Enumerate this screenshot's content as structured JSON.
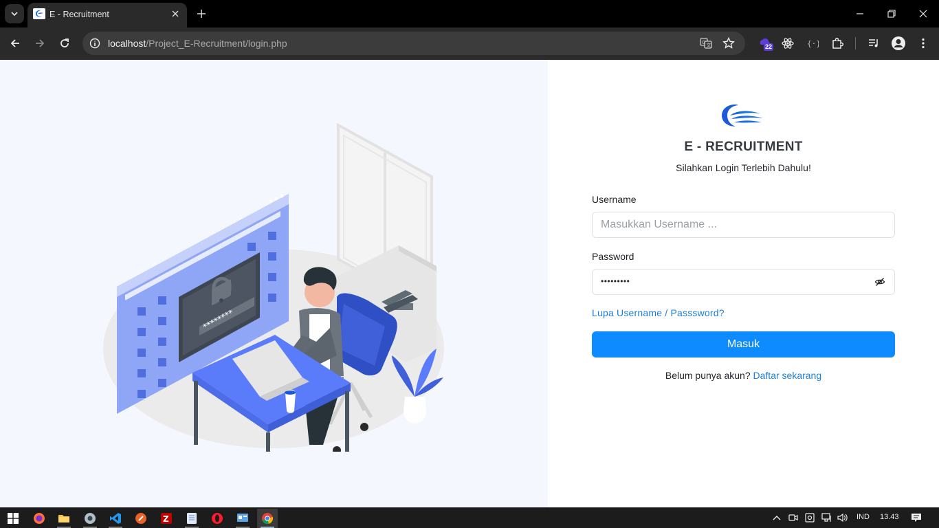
{
  "browser": {
    "tab_title": "E - Recruitment",
    "url_host": "localhost",
    "url_path": "/Project_E-Recruitment/login.php",
    "extension_badge": "22"
  },
  "login": {
    "brand_title": "E - RECRUITMENT",
    "subtitle": "Silahkan Login Terlebih Dahulu!",
    "username_label": "Username",
    "username_placeholder": "Masukkan Username ...",
    "password_label": "Password",
    "password_mask": "•••••••••",
    "forgot_link": "Lupa Username / Passsword?",
    "submit_label": "Masuk",
    "register_prompt": "Belum punya akun?",
    "register_link": "Daftar sekarang",
    "illustration_password_text": "********"
  },
  "taskbar": {
    "apps": [
      "firefox",
      "file-explorer",
      "chrome-dev",
      "vscode",
      "app-orange",
      "filezilla",
      "notepad",
      "opera",
      "control-panel",
      "chrome"
    ],
    "language": "IND",
    "clock": "13.43"
  },
  "colors": {
    "accent": "#0d8bff",
    "link": "#1c7ed6",
    "illustration_primary": "#5b7cfa",
    "left_bg": "#f5f7ff"
  }
}
